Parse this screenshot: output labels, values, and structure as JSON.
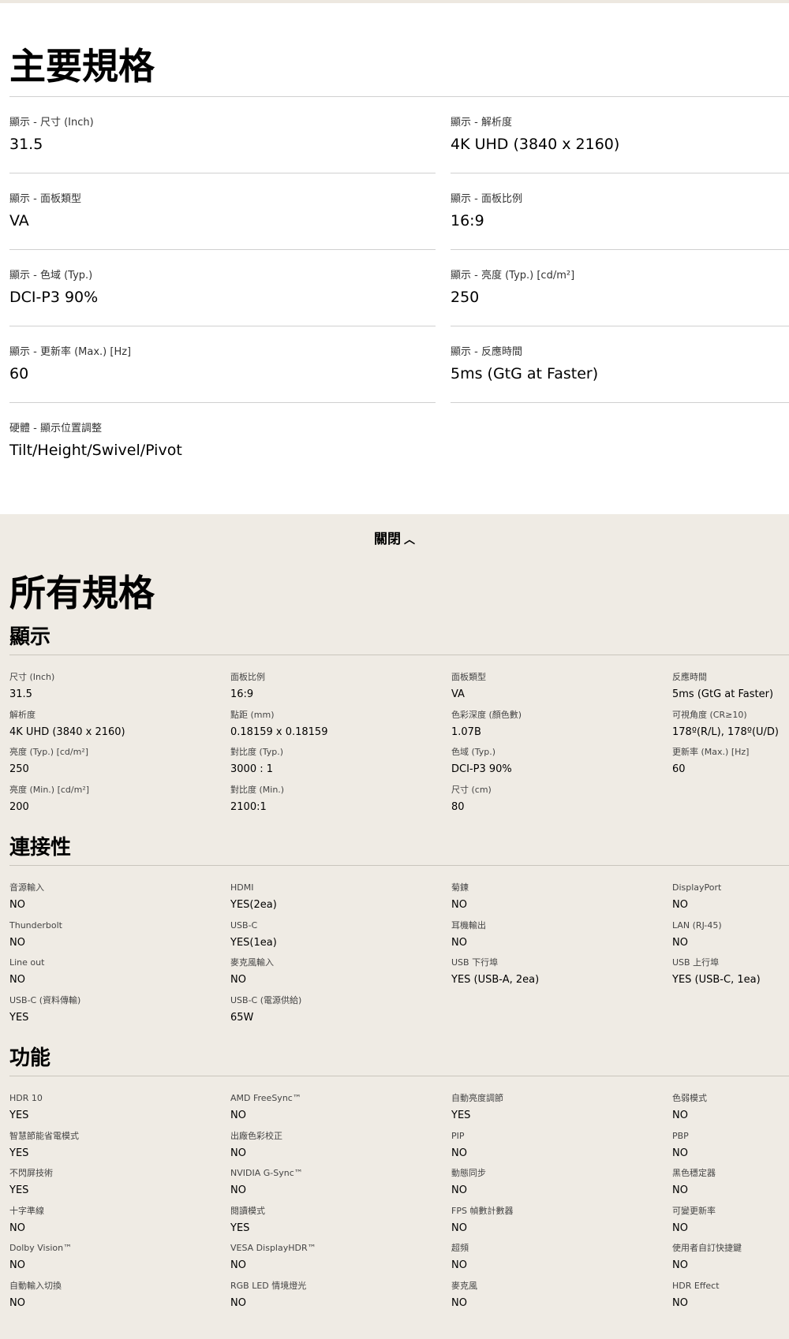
{
  "key_specs": {
    "title": "主要規格",
    "items": [
      {
        "label": "顯示 - 尺寸 (Inch)",
        "value": "31.5"
      },
      {
        "label": "顯示 - 解析度",
        "value": "4K UHD (3840 x 2160)"
      },
      {
        "label": "顯示 - 面板類型",
        "value": "VA"
      },
      {
        "label": "顯示 - 面板比例",
        "value": "16:9"
      },
      {
        "label": "顯示 - 色域 (Typ.)",
        "value": "DCI-P3 90%"
      },
      {
        "label": "顯示 - 亮度 (Typ.) [cd/m²]",
        "value": "250"
      },
      {
        "label": "顯示 - 更新率 (Max.) [Hz]",
        "value": "60"
      },
      {
        "label": "顯示 - 反應時間",
        "value": "5ms (GtG at Faster)"
      },
      {
        "label": "硬體 - 顯示位置調整",
        "value": "Tilt/Height/Swivel/Pivot"
      }
    ]
  },
  "close_button": {
    "label": "關閉",
    "icon": "chevron-up-icon"
  },
  "all_specs": {
    "title": "所有規格",
    "sections": [
      {
        "title": "顯示",
        "rows": [
          [
            {
              "label": "尺寸 (Inch)",
              "value": "31.5"
            },
            {
              "label": "面板比例",
              "value": "16:9"
            },
            {
              "label": "面板類型",
              "value": "VA"
            },
            {
              "label": "反應時間",
              "value": "5ms (GtG at Faster)"
            }
          ],
          [
            {
              "label": "解析度",
              "value": "4K UHD (3840 x 2160)"
            },
            {
              "label": "點距 (mm)",
              "value": "0.18159 x 0.18159"
            },
            {
              "label": "色彩深度 (顏色數)",
              "value": "1.07B"
            },
            {
              "label": "可視角度 (CR≥10)",
              "value": "178º(R/L), 178º(U/D)"
            }
          ],
          [
            {
              "label": "亮度 (Typ.) [cd/m²]",
              "value": "250"
            },
            {
              "label": "對比度 (Typ.)",
              "value": "3000 : 1"
            },
            {
              "label": "色域 (Typ.)",
              "value": "DCI-P3 90%"
            },
            {
              "label": "更新率 (Max.) [Hz]",
              "value": "60"
            }
          ],
          [
            {
              "label": "亮度 (Min.) [cd/m²]",
              "value": "200"
            },
            {
              "label": "對比度 (Min.)",
              "value": "2100:1"
            },
            {
              "label": "尺寸 (cm)",
              "value": "80"
            },
            null
          ]
        ]
      },
      {
        "title": "連接性",
        "rows": [
          [
            {
              "label": "音源輸入",
              "value": "NO"
            },
            {
              "label": "HDMI",
              "value": "YES(2ea)"
            },
            {
              "label": "菊鍊",
              "value": "NO"
            },
            {
              "label": "DisplayPort",
              "value": "NO"
            }
          ],
          [
            {
              "label": "Thunderbolt",
              "value": "NO"
            },
            {
              "label": "USB-C",
              "value": "YES(1ea)"
            },
            {
              "label": "耳機輸出",
              "value": "NO"
            },
            {
              "label": "LAN (RJ-45)",
              "value": "NO"
            }
          ],
          [
            {
              "label": "Line out",
              "value": "NO"
            },
            {
              "label": "麥克風輸入",
              "value": "NO"
            },
            {
              "label": "USB 下行埠",
              "value": "YES (USB-A, 2ea)"
            },
            {
              "label": "USB 上行埠",
              "value": "YES (USB-C, 1ea)"
            }
          ],
          [
            {
              "label": "USB-C (資料傳輸)",
              "value": "YES"
            },
            {
              "label": "USB-C (電源供給)",
              "value": "65W"
            },
            null,
            null
          ]
        ]
      },
      {
        "title": "功能",
        "rows": [
          [
            {
              "label": "HDR 10",
              "value": "YES"
            },
            {
              "label": "AMD FreeSync™",
              "value": "NO"
            },
            {
              "label": "自動亮度調節",
              "value": "YES"
            },
            {
              "label": "色弱模式",
              "value": "NO"
            }
          ],
          [
            {
              "label": "智慧節能省電模式",
              "value": "YES"
            },
            {
              "label": "出廠色彩校正",
              "value": "NO"
            },
            {
              "label": "PIP",
              "value": "NO"
            },
            {
              "label": "PBP",
              "value": "NO"
            }
          ],
          [
            {
              "label": "不閃屏技術",
              "value": "YES"
            },
            {
              "label": "NVIDIA G-Sync™",
              "value": "NO"
            },
            {
              "label": "動態同步",
              "value": "NO"
            },
            {
              "label": "黑色穩定器",
              "value": "NO"
            }
          ],
          [
            {
              "label": "十字準線",
              "value": "NO"
            },
            {
              "label": "閱讀模式",
              "value": "YES"
            },
            {
              "label": "FPS 幀數計數器",
              "value": "NO"
            },
            {
              "label": "可變更新率",
              "value": "NO"
            }
          ],
          [
            {
              "label": "Dolby Vision™",
              "value": "NO"
            },
            {
              "label": "VESA DisplayHDR™",
              "value": "NO"
            },
            {
              "label": "超頻",
              "value": "NO"
            },
            {
              "label": "使用者自訂快捷鍵",
              "value": "NO"
            }
          ],
          [
            {
              "label": "自動輸入切換",
              "value": "NO"
            },
            {
              "label": "RGB LED 情境燈光",
              "value": "NO"
            },
            {
              "label": "麥克風",
              "value": "NO"
            },
            {
              "label": "HDR Effect",
              "value": "NO"
            }
          ]
        ]
      }
    ]
  }
}
